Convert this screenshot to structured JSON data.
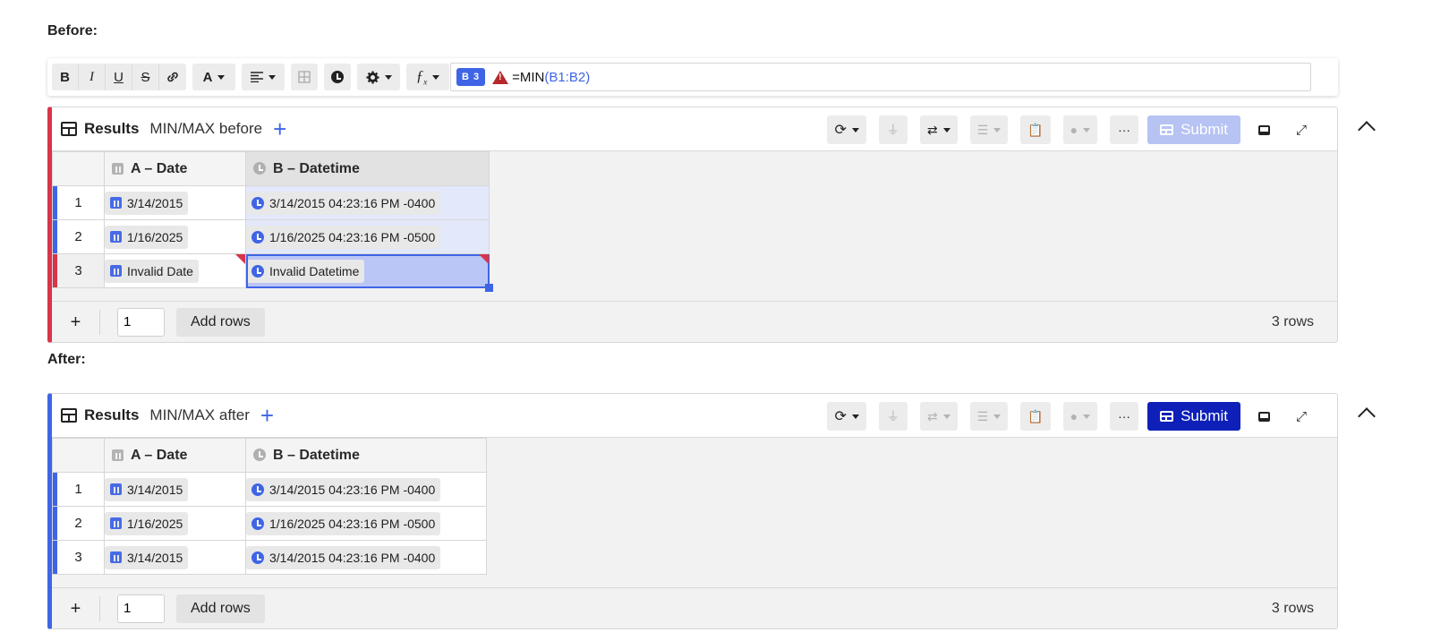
{
  "before_label": "Before:",
  "after_label": "After:",
  "toolbar": {
    "bold": "B",
    "italic": "I",
    "underline": "U",
    "strike": "S",
    "font_color": "A",
    "cell_ref": "B 3",
    "formula": {
      "prefix": "=MIN",
      "open": "(",
      "range": "B1:B2",
      "close": ")"
    }
  },
  "before": {
    "title": "Results",
    "name": "MIN/MAX before",
    "submit_label": "Submit",
    "columns": [
      "A – Date",
      "B – Datetime"
    ],
    "rows": [
      {
        "num": "1",
        "a": "3/14/2015",
        "b": "3/14/2015 04:23:16 PM -0400"
      },
      {
        "num": "2",
        "a": "1/16/2025",
        "b": "1/16/2025 04:23:16 PM -0500"
      },
      {
        "num": "3",
        "a": "Invalid Date",
        "b": "Invalid Datetime"
      }
    ],
    "rows_input": "1",
    "add_rows_label": "Add rows",
    "row_count": "3 rows"
  },
  "after": {
    "title": "Results",
    "name": "MIN/MAX after",
    "submit_label": "Submit",
    "columns": [
      "A – Date",
      "B – Datetime"
    ],
    "rows": [
      {
        "num": "1",
        "a": "3/14/2015",
        "b": "3/14/2015 04:23:16 PM -0400"
      },
      {
        "num": "2",
        "a": "1/16/2025",
        "b": "1/16/2025 04:23:16 PM -0500"
      },
      {
        "num": "3",
        "a": "3/14/2015",
        "b": "3/14/2015 04:23:16 PM -0400"
      }
    ],
    "rows_input": "1",
    "add_rows_label": "Add rows",
    "row_count": "3 rows"
  },
  "colors": {
    "accent": "#3f65e6",
    "error": "#d8344a",
    "submit_active": "#0e20b8",
    "submit_disabled": "#b6c3f3"
  }
}
